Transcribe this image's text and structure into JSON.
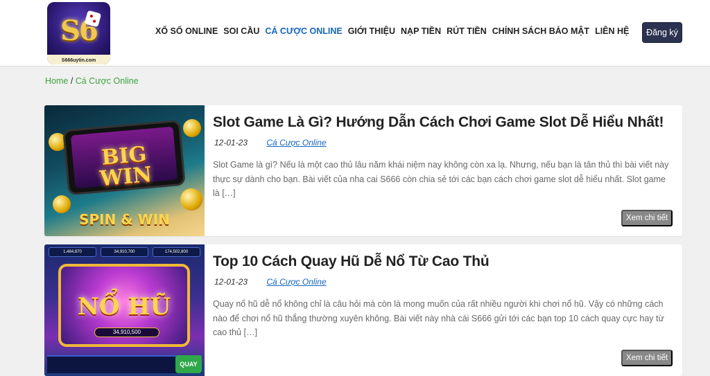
{
  "header": {
    "logo_domain": "S666uytin.com",
    "nav": [
      {
        "label": "XỔ SỐ ONLINE",
        "active": false
      },
      {
        "label": "SOI CẦU",
        "active": false
      },
      {
        "label": "CÁ CƯỢC ONLINE",
        "active": true
      },
      {
        "label": "GIỚI THIỆU",
        "active": false
      },
      {
        "label": "NẠP TIỀN",
        "active": false
      },
      {
        "label": "RÚT TIỀN",
        "active": false
      },
      {
        "label": "CHÍNH SÁCH BẢO MẬT",
        "active": false
      },
      {
        "label": "LIÊN HỆ",
        "active": false
      }
    ],
    "signup_label": "Đăng ký"
  },
  "breadcrumb": {
    "home": "Home",
    "separator": " / ",
    "current": "Cá Cược Online"
  },
  "posts": [
    {
      "title": "Slot Game Là Gì? Hướng Dẫn Cách Chơi Game Slot Dễ Hiểu Nhất!",
      "date": "12-01-23",
      "category": "Cá Cược Online",
      "excerpt": "Slot Game là gì? Nếu là một cao thủ lâu năm khái niệm nay không còn xa lạ. Nhưng, nếu bạn là tân thủ thì bài viết này thực sự dành cho bạn. Bài viết của nha cai S666 còn chia sẻ tới các bạn cách chơi game slot dễ hiểu nhất. Slot game là […]",
      "more_label": "Xem chi tiết",
      "image_text_top": "BIG WIN",
      "image_text_bottom": "SPIN & WIN"
    },
    {
      "title": "Top 10 Cách Quay Hũ Dễ Nổ Từ Cao Thủ",
      "date": "12-01-23",
      "category": "Cá Cược Online",
      "excerpt": "Quay nổ hũ dễ nổ không chỉ là câu hỏi mà còn là mong muốn của rất nhiều người khi chơi nổ hũ. Vậy có những cách nào để chơi nổ hũ thắng thường xuyên không. Bài viết này nhà cái S666 gửi tới các bạn top 10 cách quay cực hay từ cao thủ […]",
      "more_label": "Xem chi tiết",
      "image_text_top": "NỔ HŨ",
      "image_jackpot": "34,910,500",
      "image_chips": [
        "1,484,870",
        "34,910,700",
        "174,502,800"
      ],
      "image_button": "QUAY"
    }
  ],
  "colors": {
    "nav_active": "#1565c0",
    "breadcrumb": "#3aa53a",
    "signup_bg": "#2c3350",
    "more_bg": "#888888"
  }
}
